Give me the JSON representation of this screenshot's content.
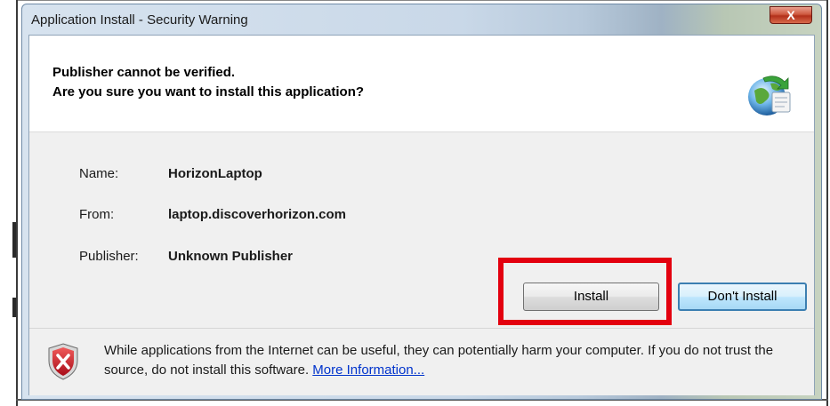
{
  "window": {
    "title": "Application Install - Security Warning",
    "close_label": "X"
  },
  "header": {
    "line1": "Publisher cannot be verified.",
    "line2": "Are you sure you want to install this application?"
  },
  "fields": [
    {
      "label": "Name:",
      "value": "HorizonLaptop"
    },
    {
      "label": "From:",
      "value": "laptop.discoverhorizon.com"
    },
    {
      "label": "Publisher:",
      "value": "Unknown Publisher"
    }
  ],
  "buttons": {
    "install": "Install",
    "dont_install": "Don't Install"
  },
  "warning": {
    "text": "While applications from the Internet can be useful, they can potentially harm your computer. If you do not trust the source, do not install this software.",
    "link": "More Information..."
  },
  "colors": {
    "highlight": "#e3000f",
    "link": "#0033cc",
    "shield": "#c8102e"
  },
  "icons": {
    "app": "globe-install-icon",
    "warning": "security-shield-icon"
  }
}
